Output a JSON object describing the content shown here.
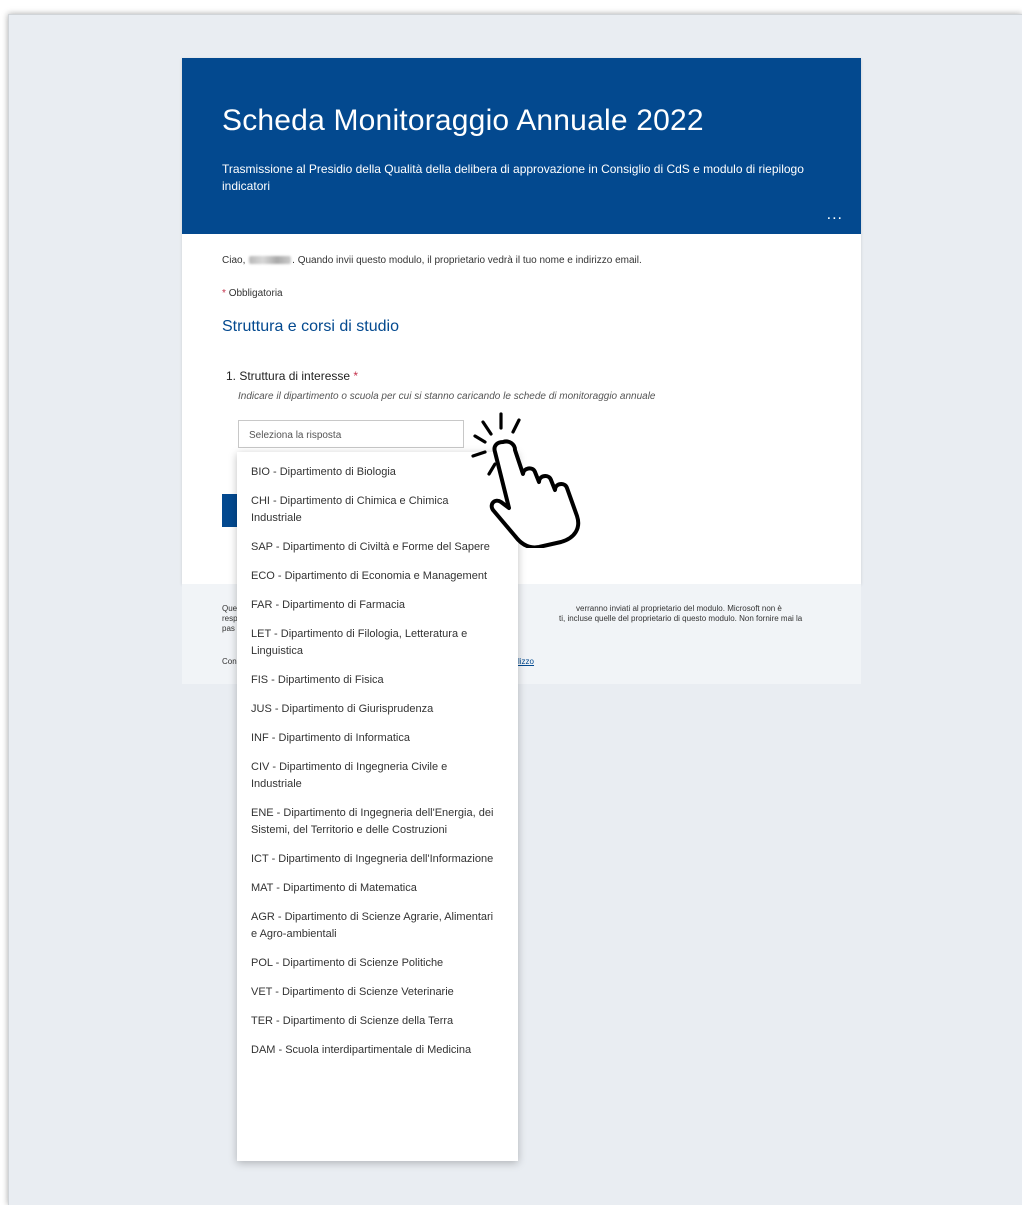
{
  "header": {
    "title": "Scheda Monitoraggio Annuale 2022",
    "subtitle": "Trasmissione al Presidio della Qualità della delibera di approvazione in Consiglio di CdS e modulo di riepilogo indicatori",
    "more_label": "..."
  },
  "greeting": {
    "prefix": "Ciao,",
    "suffix": ". Quando invii questo modulo, il proprietario vedrà il tuo nome e indirizzo email."
  },
  "required_note": "Obbligatoria",
  "required_marker": "*",
  "section_title": "Struttura e corsi di studio",
  "question": {
    "label": "1. Struttura di interesse",
    "hint": "Indicare il dipartimento o scuola per cui si stanno caricando le schede di monitoraggio annuale",
    "placeholder": "Seleziona la risposta"
  },
  "dropdown": {
    "options": [
      "BIO - Dipartimento di Biologia",
      "CHI - Dipartimento di Chimica e Chimica Industriale",
      "SAP - Dipartimento di Civiltà e Forme del Sapere",
      "ECO - Dipartimento di Economia e Management",
      "FAR - Dipartimento di Farmacia",
      "LET - Dipartimento di Filologia, Letteratura e Linguistica",
      "FIS - Dipartimento di Fisica",
      "JUS - Dipartimento di Giurisprudenza",
      "INF - Dipartimento di Informatica",
      "CIV - Dipartimento di Ingegneria Civile e Industriale",
      "ENE - Dipartimento di Ingegneria dell'Energia, dei Sistemi, del Territorio e delle Costruzioni",
      "ICT - Dipartimento di Ingegneria dell'Informazione",
      "MAT - Dipartimento di Matematica",
      "AGR - Dipartimento di Scienze Agrarie, Alimentari e Agro-ambientali",
      "POL - Dipartimento di Scienze Politiche",
      "VET - Dipartimento di Scienze Veterinarie",
      "TER - Dipartimento di Scienze della Terra",
      "DAM - Scuola interdipartimentale di Medicina"
    ]
  },
  "footer": {
    "line1_start": "Que",
    "line1_end": "verranno inviati al proprietario del modulo. Microsoft non è",
    "line2_start": "resp",
    "line2_end": "ti, incluse quelle del proprietario di questo modulo. Non fornire mai la",
    "line3_start": "pas",
    "line4_start": "Con",
    "link_fragment": "lizzo"
  },
  "colors": {
    "brand": "#03498f",
    "required": "#c4314b",
    "page_bg": "#e9edf2"
  },
  "icons": {
    "cursor": "tap-hand-icon"
  }
}
